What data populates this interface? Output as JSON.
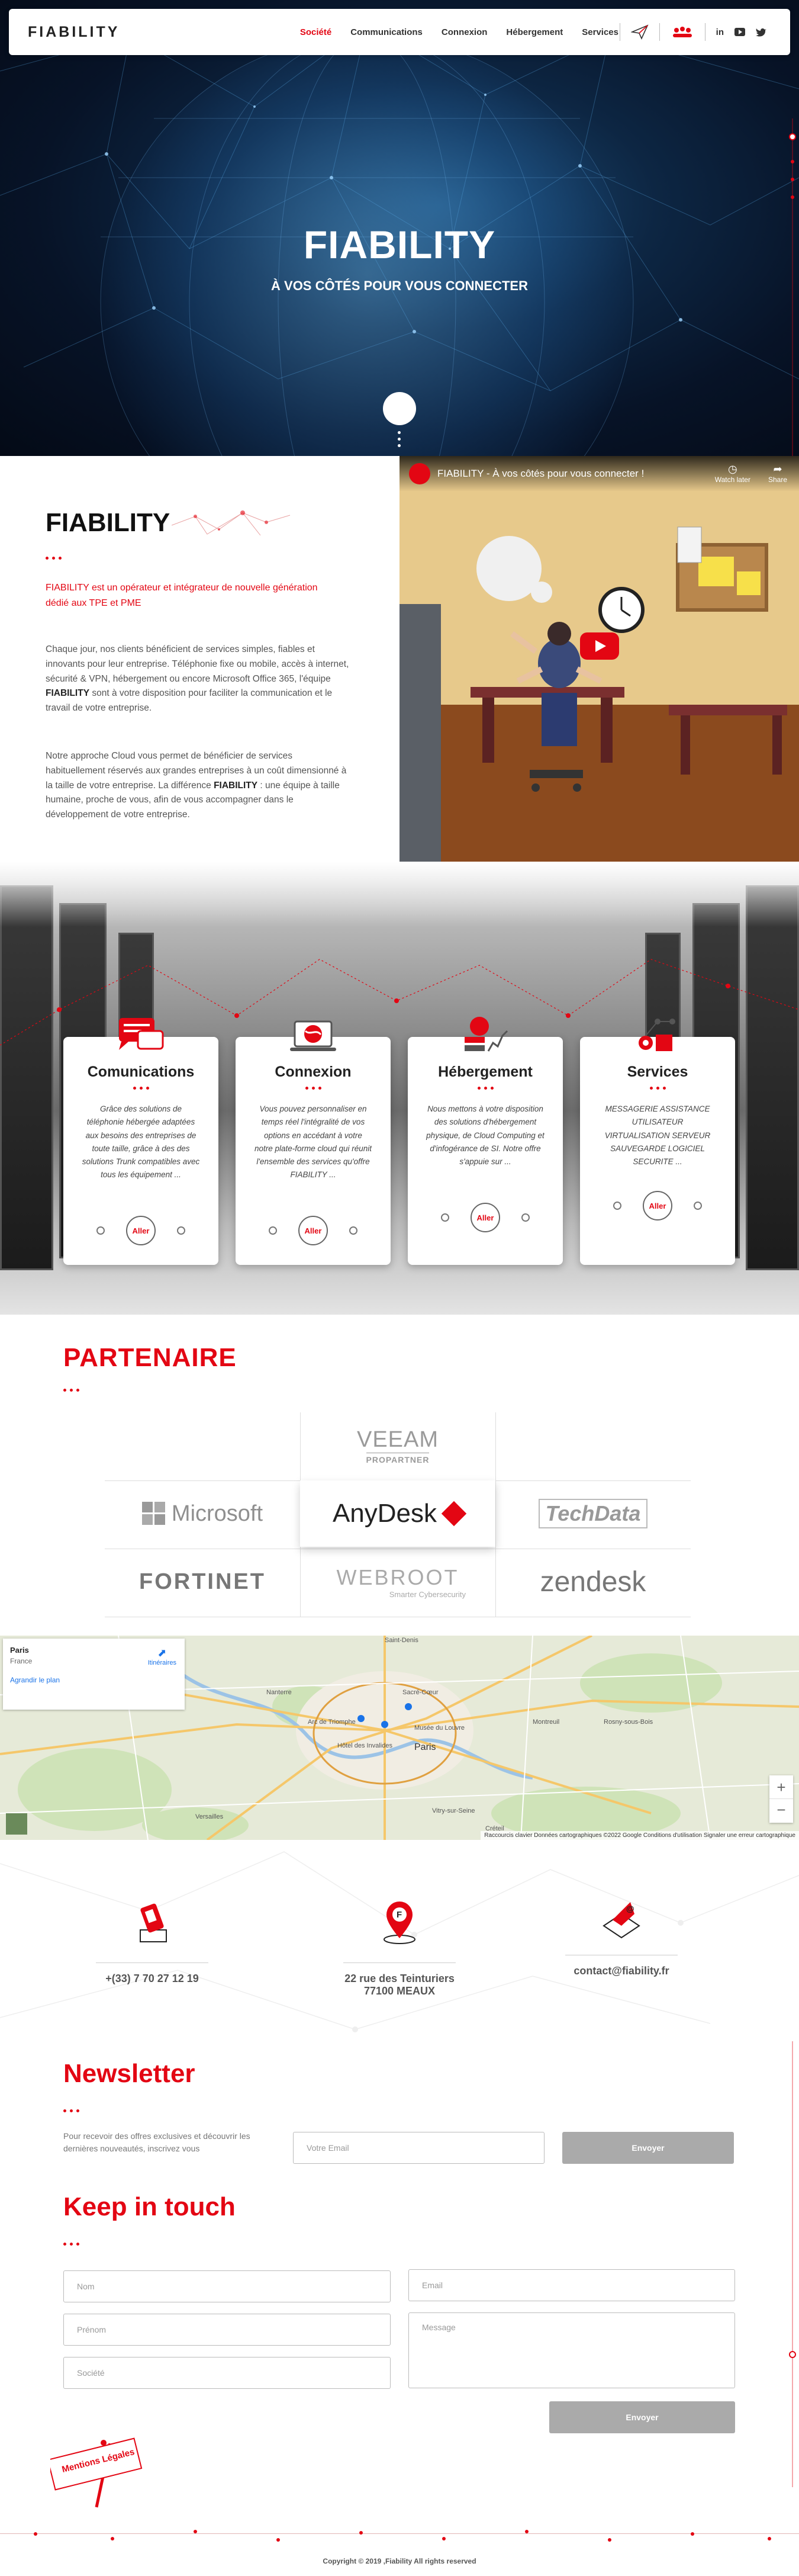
{
  "nav": {
    "logo": "FIABILITY",
    "menu": [
      {
        "label": "Société",
        "active": true
      },
      {
        "label": "Communications",
        "active": false
      },
      {
        "label": "Connexion",
        "active": false
      },
      {
        "label": "Hébergement",
        "active": false
      },
      {
        "label": "Services",
        "active": false
      }
    ],
    "social": [
      "in",
      "youtube-icon",
      "twitter-icon"
    ]
  },
  "hero": {
    "title": "FIABILITY",
    "subtitle": "À VOS CÔTÉS POUR VOUS CONNECTER"
  },
  "about": {
    "title": "FIABILITY",
    "lead": "FIABILITY est un opérateur et intégrateur de nouvelle génération dédié aux TPE et PME",
    "p1_a": "Chaque jour, nos clients bénéficient de services simples, fiables et innovants pour leur entreprise. Téléphonie fixe ou mobile, accès à internet, sécurité & VPN, hébergement ou encore Microsoft Office 365, l'équipe ",
    "p1_b": "FIABILITY",
    "p1_c": " sont à votre disposition pour faciliter la communication et le travail de votre entreprise.",
    "p2_a": "Notre approche Cloud vous permet de bénéficier de services habituellement réservés aux grandes entreprises à un coût dimensionné à la taille de votre entreprise. La différence ",
    "p2_b": "FIABILITY",
    "p2_c": " : une équipe à taille humaine, proche de vous, afin de vous accompagner dans le développement de votre entreprise."
  },
  "video": {
    "title": "FIABILITY - À vos côtés pour vous connecter !",
    "watch_later": "Watch later",
    "share": "Share"
  },
  "services": [
    {
      "title": "Comunications",
      "text": "Grâce des solutions de téléphonie hébergée adaptées aux besoins des entreprises de toute taille, grâce à des des solutions Trunk compatibles avec tous les équipement ...",
      "button": "Aller"
    },
    {
      "title": "Connexion",
      "text": "Vous pouvez personnaliser en temps réel l'intégralité de vos options en accédant à votre notre plate-forme cloud qui réunit l'ensemble des services qu'offre FIABILITY ...",
      "button": "Aller"
    },
    {
      "title": "Hébergement",
      "text": "Nous mettons à votre disposition des solutions d'hébergement physique, de Cloud Computing et d'infogérance de SI. Notre offre s'appuie sur ...",
      "button": "Aller"
    },
    {
      "title": "Services",
      "text": "MESSAGERIE ASSISTANCE UTILISATEUR VIRTUALISATION SERVEUR SAUVEGARDE LOGICIEL SECURITE ...",
      "button": "Aller"
    }
  ],
  "partners": {
    "title": "PARTENAIRE",
    "logos": {
      "veeam": "VEEAM",
      "veeam_sub": "PROPARTNER",
      "microsoft": "Microsoft",
      "anydesk": "AnyDesk",
      "techdata": "TechData",
      "fortinet": "FORTINET",
      "webroot": "WEBROOT",
      "webroot_sub": "Smarter Cybersecurity",
      "zendesk": "zendesk"
    }
  },
  "map": {
    "place": "Paris",
    "country": "France",
    "enlarge": "Agrandir le plan",
    "directions": "Itinéraires",
    "labels": [
      "Saint-Denis",
      "Nanterre",
      "Sacré-Cœur",
      "Arc de Triomphe",
      "Musée du Louvre",
      "Hôtel des Invalides",
      "Paris",
      "Versailles",
      "Créteil",
      "Vitry-sur-Seine",
      "Rosny-sous-Bois",
      "Montreuil"
    ],
    "footer": "Raccourcis clavier   Données cartographiques ©2022 Google   Conditions d'utilisation   Signaler une erreur cartographique"
  },
  "contact": {
    "phone": "+(33) 7 70 27 12 19",
    "address_1": "22 rue des Teinturiers",
    "address_2": "77100 MEAUX",
    "email": "contact@fiability.fr"
  },
  "newsletter": {
    "title": "Newsletter",
    "text": "Pour recevoir des offres exclusives et découvrir les dernières nouveautés, inscrivez vous",
    "placeholder": "Votre Email",
    "button": "Envoyer"
  },
  "keep": {
    "title": "Keep in touch",
    "nom": "Nom",
    "prenom": "Prénom",
    "societe": "Société",
    "email": "Email",
    "message": "Message",
    "button": "Envoyer"
  },
  "mentions": "Mentions Légales",
  "footer": "Copyright © 2019 ,Fiability All rights reserved",
  "colors": {
    "accent": "#e30613",
    "dark": "#222222",
    "grey_button": "#aaaaaa"
  }
}
